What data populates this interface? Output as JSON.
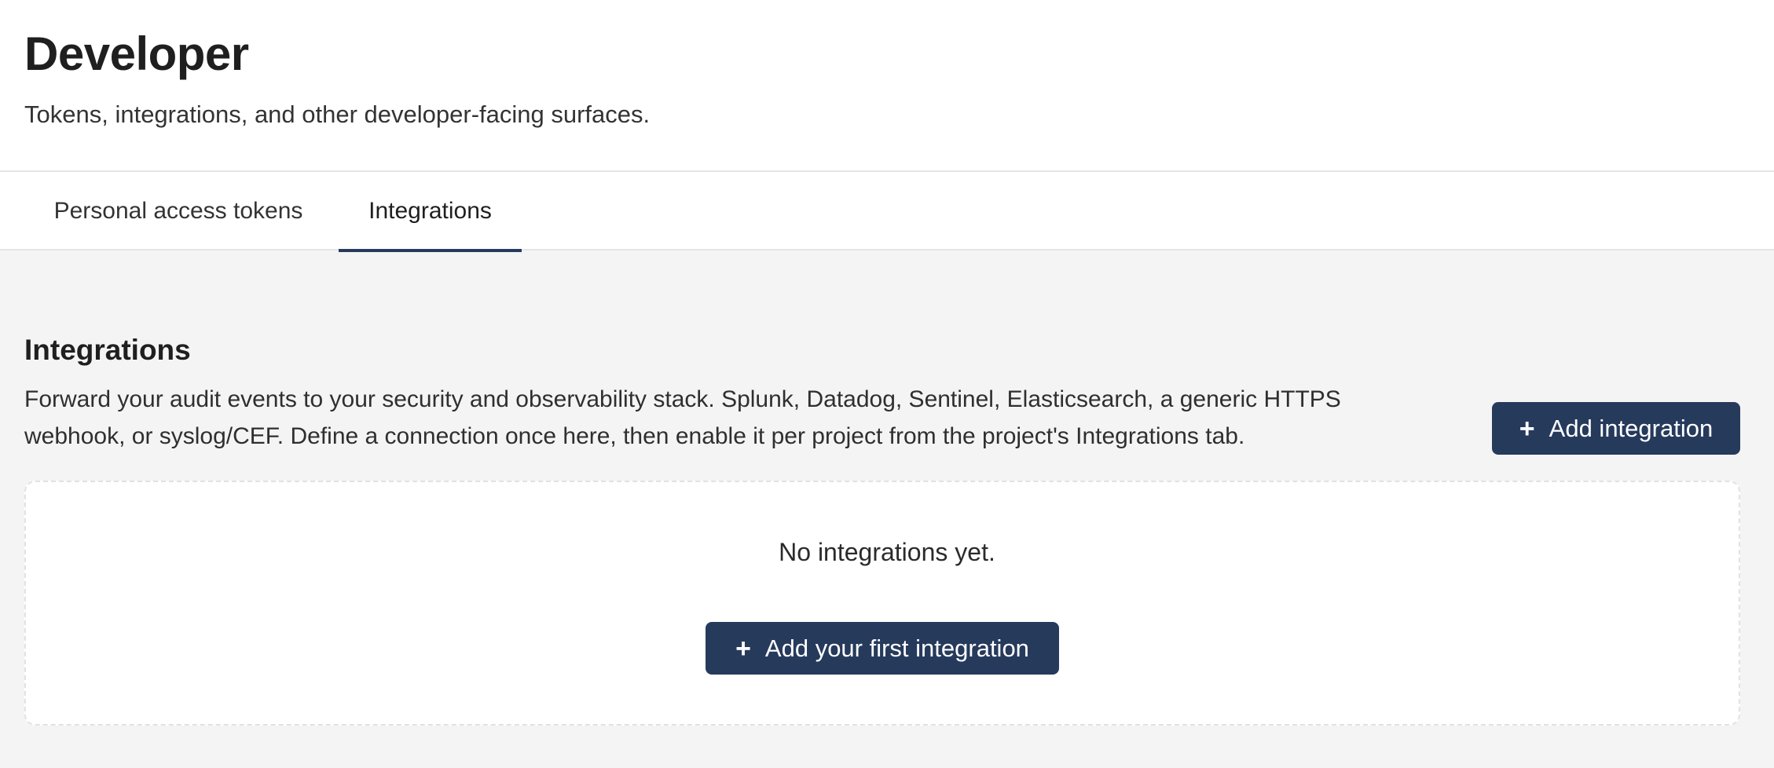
{
  "header": {
    "title": "Developer",
    "subtitle": "Tokens, integrations, and other developer-facing surfaces."
  },
  "tabs": [
    {
      "label": "Personal access tokens",
      "active": false
    },
    {
      "label": "Integrations",
      "active": true
    }
  ],
  "section": {
    "title": "Integrations",
    "description": "Forward your audit events to your security and observability stack. Splunk, Datadog, Sentinel, Elasticsearch, a generic HTTPS webhook, or syslog/CEF. Define a connection once here, then enable it per project from the project's Integrations tab.",
    "add_button_label": "Add integration",
    "add_button_icon": "plus-icon"
  },
  "empty_state": {
    "message": "No integrations yet.",
    "button_label": "Add your first integration",
    "button_icon": "plus-icon"
  },
  "colors": {
    "primary": "#263a5c",
    "background": "#f4f4f4",
    "surface": "#ffffff"
  }
}
